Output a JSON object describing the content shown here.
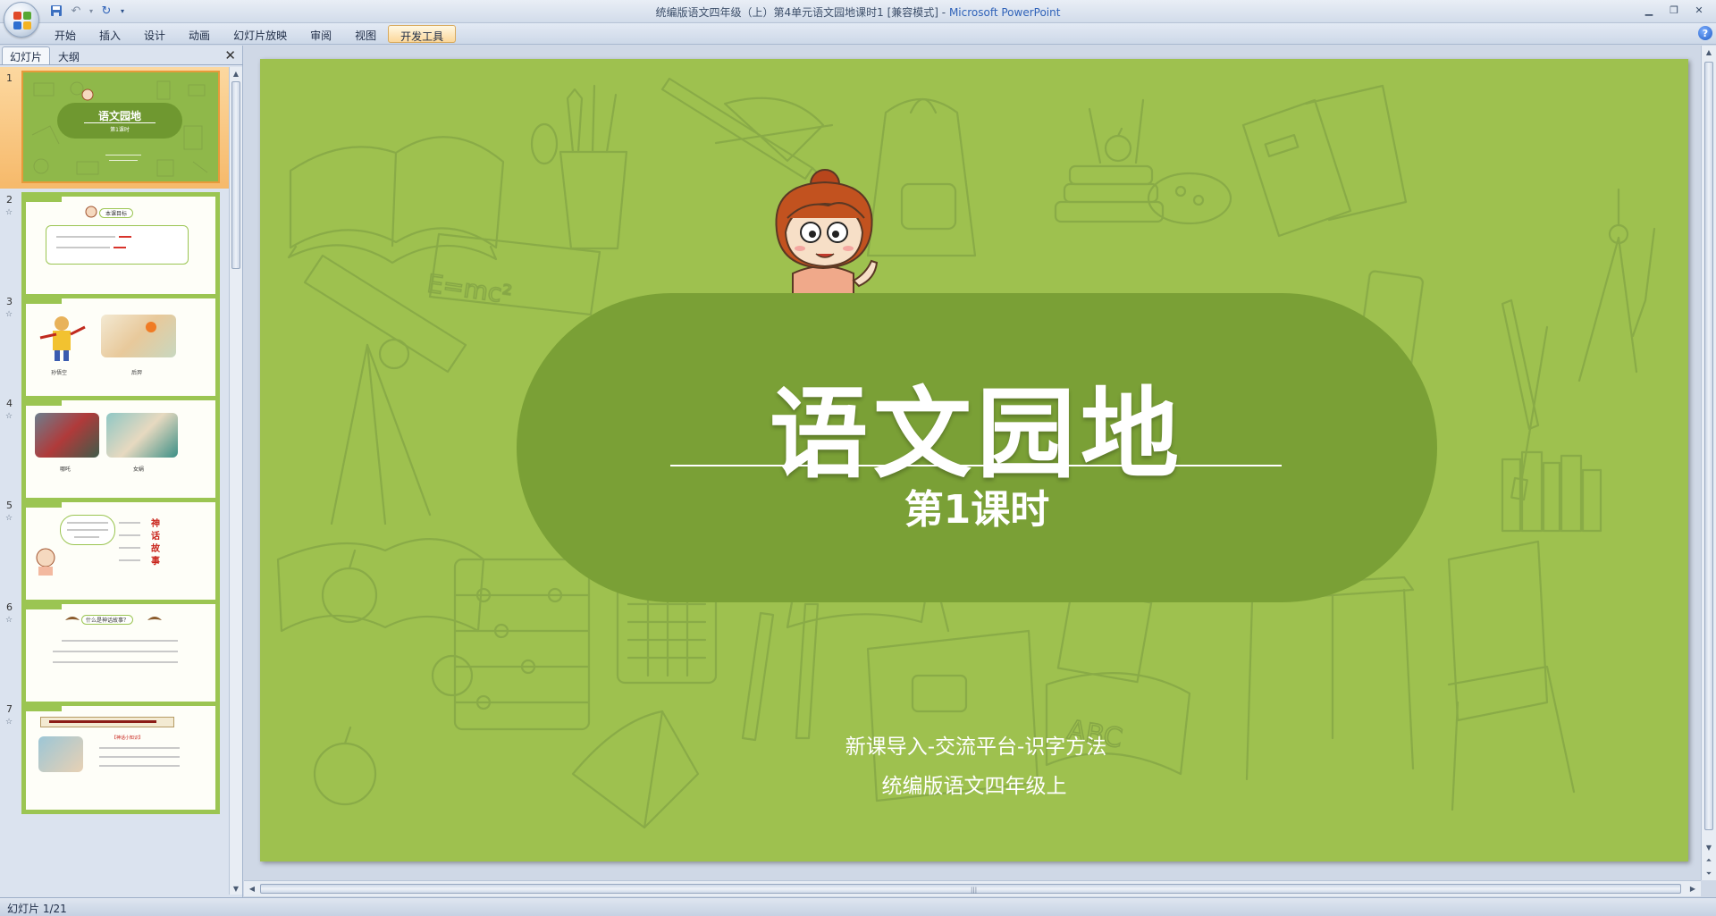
{
  "window": {
    "title": "统编版语文四年级（上）第4单元语文园地课时1 [兼容模式] - ",
    "app_name": "Microsoft PowerPoint"
  },
  "ribbon": {
    "tabs": [
      "开始",
      "插入",
      "设计",
      "动画",
      "幻灯片放映",
      "审阅",
      "视图",
      "开发工具"
    ],
    "active_tab": "开发工具"
  },
  "left_pane": {
    "tabs": [
      "幻灯片",
      "大纲"
    ],
    "active_tab": "幻灯片",
    "close_label": "✕",
    "thumbnails": [
      {
        "num": "1",
        "title": "语文园地",
        "subtitle": "第1课时"
      },
      {
        "num": "2",
        "heading": "本课目标"
      },
      {
        "num": "3",
        "labels": [
          "孙悟空",
          "后羿"
        ]
      },
      {
        "num": "4",
        "labels": [
          "哪吒",
          "女娲"
        ]
      },
      {
        "num": "5",
        "side_text": "神话故事"
      },
      {
        "num": "6",
        "heading": "什么是神话故事？"
      },
      {
        "num": "7",
        "heading": "【神话小知识】"
      }
    ]
  },
  "slide": {
    "title": "语文园地",
    "subtitle": "第1课时",
    "caption_1": "新课导入-交流平台-识字方法",
    "caption_2": "统编版语文四年级上"
  },
  "status": {
    "slide_counter": "幻灯片 1/21"
  },
  "colors": {
    "slide_bg": "#9ec14f",
    "banner": "#7aa036",
    "selection": "#f6b96a"
  }
}
